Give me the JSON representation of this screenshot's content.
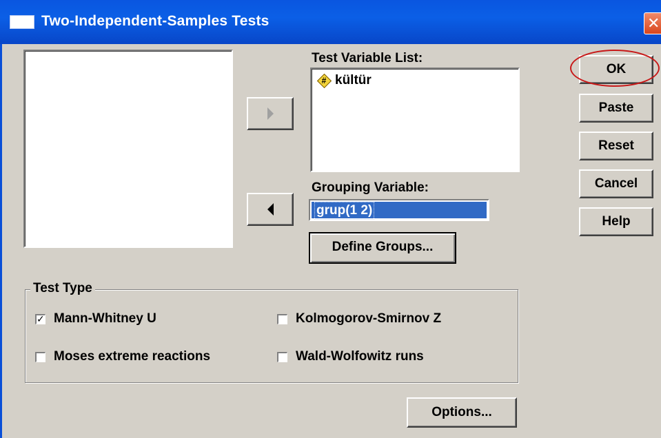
{
  "dialog": {
    "title": "Two-Independent-Samples Tests",
    "close_glyph": "✕"
  },
  "test_variable_list": {
    "label": "Test Variable List:",
    "items": [
      {
        "icon": "numeric-variable-icon",
        "name": "kültür"
      }
    ]
  },
  "grouping_variable": {
    "label": "Grouping Variable:",
    "value": "grup(1 2)"
  },
  "define_groups_button": "Define Groups...",
  "side_buttons": {
    "ok": "OK",
    "paste": "Paste",
    "reset": "Reset",
    "cancel": "Cancel",
    "help": "Help"
  },
  "test_type": {
    "legend": "Test Type",
    "options": [
      {
        "label": "Mann-Whitney U",
        "checked": true
      },
      {
        "label": "Kolmogorov-Smirnov Z",
        "checked": false
      },
      {
        "label": "Moses extreme reactions",
        "checked": false
      },
      {
        "label": "Wald-Wolfowitz runs",
        "checked": false
      }
    ]
  },
  "options_button": "Options...",
  "colors": {
    "titlebar": "#0b5fe6",
    "dialog_bg": "#d4d0c8",
    "selection": "#316ac5",
    "annotation_ring": "#c81818"
  }
}
